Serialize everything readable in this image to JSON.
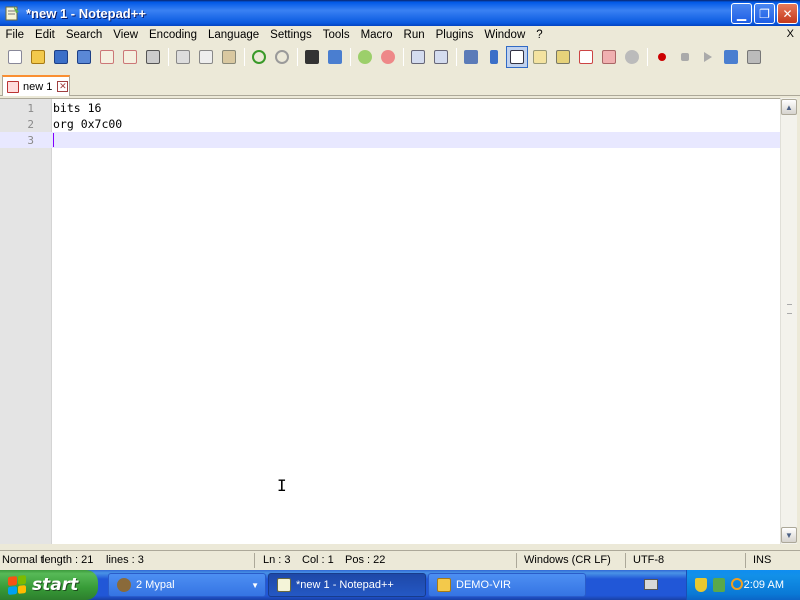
{
  "window": {
    "title": "*new 1 - Notepad++",
    "btn_minimize": "▁",
    "btn_maximize": "❐",
    "btn_close": "✕"
  },
  "menu": {
    "items": [
      "File",
      "Edit",
      "Search",
      "View",
      "Encoding",
      "Language",
      "Settings",
      "Tools",
      "Macro",
      "Run",
      "Plugins",
      "Window",
      "?"
    ],
    "close_label": "X"
  },
  "toolbar": {
    "icons": [
      "new-icon",
      "open-icon",
      "save-icon",
      "save-all-icon",
      "close-icon",
      "close-all-icon",
      "print-icon",
      "cut-icon",
      "copy-icon",
      "paste-icon",
      "undo-icon",
      "redo-icon",
      "find-icon",
      "replace-icon",
      "zoom-in-icon",
      "zoom-out-icon",
      "sync-vertical-icon",
      "sync-horizontal-icon",
      "word-wrap-icon",
      "show-all-chars-icon",
      "indent-guide-icon",
      "user-language-icon",
      "document-map-icon",
      "function-list-icon",
      "folder-workspace-icon",
      "monitoring-icon",
      "record-macro-icon",
      "stop-macro-icon",
      "play-macro-icon",
      "run-macro-multiple-icon",
      "save-macro-icon"
    ],
    "active_icon": "indent-guide-icon"
  },
  "tabs": [
    {
      "label": "new 1",
      "close": "✕"
    }
  ],
  "editor": {
    "lines": [
      {
        "num": "1",
        "text": "bits 16"
      },
      {
        "num": "2",
        "text": "org 0x7c00"
      },
      {
        "num": "3",
        "text": ""
      }
    ],
    "current_line": 3
  },
  "statusbar": {
    "mode": "Normal t",
    "length": "length : 21",
    "lines": "lines : 3",
    "ln": "Ln : 3",
    "col": "Col : 1",
    "pos": "Pos : 22",
    "eol": "Windows (CR LF)",
    "encoding": "UTF-8",
    "insert": "INS"
  },
  "taskbar": {
    "start_label": "start",
    "tasks": [
      {
        "label": "2 Mypal",
        "arrow": "▼"
      },
      {
        "label": "*new 1 - Notepad++"
      },
      {
        "label": "DEMO-VIR"
      }
    ],
    "clock": "2:09 AM"
  },
  "colors": {
    "title_bar": "#0058e6",
    "tab_accent": "#fa8f31",
    "current_line": "#e8e8ff",
    "caret": "#8000ff",
    "taskbar": "#2157d7",
    "start_button": "#379b37"
  }
}
